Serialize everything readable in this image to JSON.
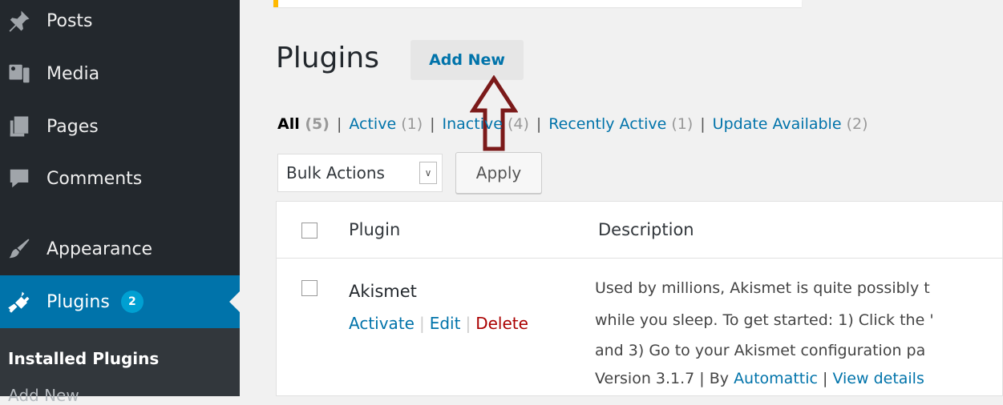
{
  "sidebar": {
    "items": [
      {
        "label": "Posts",
        "icon": "pushpin-icon"
      },
      {
        "label": "Media",
        "icon": "media-icon"
      },
      {
        "label": "Pages",
        "icon": "pages-icon"
      },
      {
        "label": "Comments",
        "icon": "comment-icon"
      },
      {
        "label": "Appearance",
        "icon": "paintbrush-icon"
      },
      {
        "label": "Plugins",
        "icon": "plugin-icon",
        "badge": "2",
        "current": true
      }
    ],
    "submenu": {
      "current": "Installed Plugins",
      "next": "Add New"
    }
  },
  "colors": {
    "sidebar_bg": "#23282d",
    "accent": "#0073aa",
    "badge": "#00a0d2",
    "delete": "#aa0000",
    "annotation_arrow": "#7b1a1a"
  },
  "page": {
    "title": "Plugins",
    "add_new_label": "Add New"
  },
  "filters": [
    {
      "label": "All",
      "count": "(5)",
      "current": true
    },
    {
      "label": "Active",
      "count": "(1)"
    },
    {
      "label": "Inactive",
      "count": "(4)"
    },
    {
      "label": "Recently Active",
      "count": "(1)"
    },
    {
      "label": "Update Available",
      "count": "(2)"
    }
  ],
  "bulk": {
    "selected": "Bulk Actions",
    "apply_label": "Apply"
  },
  "table": {
    "columns": [
      "Plugin",
      "Description"
    ],
    "rows": [
      {
        "name": "Akismet",
        "actions": {
          "activate": "Activate",
          "edit": "Edit",
          "delete": "Delete"
        },
        "description_lines": [
          "Used by millions, Akismet is quite possibly t",
          "while you sleep. To get started: 1) Click the '",
          "and 3) Go to your Akismet configuration pa"
        ],
        "meta": {
          "version": "Version 3.1.7 | By ",
          "author": "Automattic",
          "sep": " | ",
          "details": "View details"
        }
      }
    ]
  }
}
